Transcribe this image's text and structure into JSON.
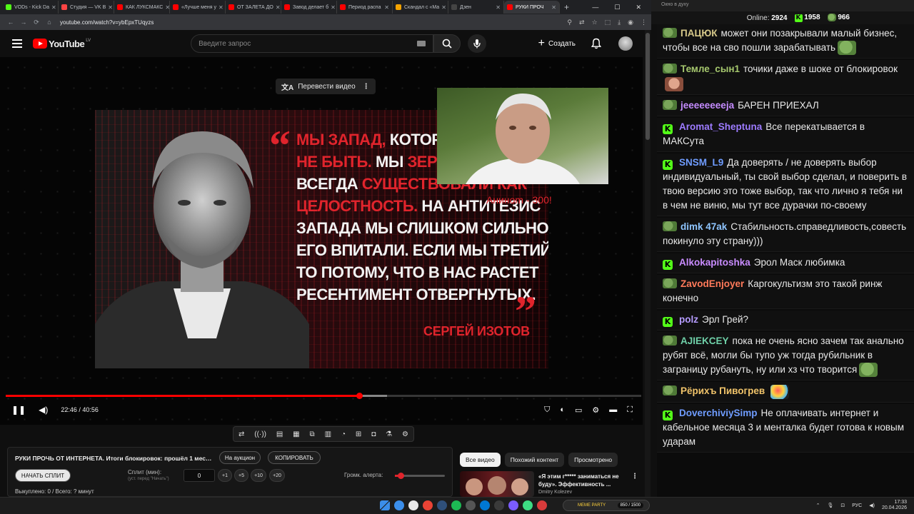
{
  "browser": {
    "tabs": [
      {
        "label": "VODs - Kick Da",
        "color": "#53fc18"
      },
      {
        "label": "Студия — VK В",
        "color": "#ff4444"
      },
      {
        "label": "КАК ЛУКСМАКС",
        "color": "#ff0000"
      },
      {
        "label": "«Лучше меня у",
        "color": "#ff0000"
      },
      {
        "label": "ОТ ЗАЛЕТА ДО",
        "color": "#ff0000"
      },
      {
        "label": "Завод делает б",
        "color": "#ff0000"
      },
      {
        "label": "Период распа",
        "color": "#ff0000"
      },
      {
        "label": "Скандал с «Ма",
        "color": "#f4a300"
      },
      {
        "label": "Дзен",
        "color": "#444444"
      },
      {
        "label": "РУКИ ПРОЧ",
        "color": "#ff0000"
      }
    ],
    "url": "youtube.com/watch?v=ybEpxTUqyzs"
  },
  "youtube": {
    "logo_text": "YouTube",
    "region": "LV",
    "search_placeholder": "Введите запрос",
    "create_label": "Создать"
  },
  "player": {
    "translate_label": "Перевести видео",
    "quote_lines": [
      [
        {
          "t": "Мы запад, ",
          "red": true
        },
        {
          "t": "который с",
          "red": false
        }
      ],
      [
        {
          "t": "не быть. ",
          "red": true
        },
        {
          "t": "Мы ",
          "red": false
        },
        {
          "t": "зеркало",
          "red": true
        }
      ],
      [
        {
          "t": "всегда  ",
          "red": false
        },
        {
          "t": "существовали как",
          "red": true
        }
      ],
      [
        {
          "t": "целостность. ",
          "red": true
        },
        {
          "t": "На антитезис",
          "red": false
        }
      ],
      [
        {
          "t": "запада мы слишком сильно",
          "red": false
        }
      ],
      [
        {
          "t": "его впитали. Если мы третий путь,",
          "red": false
        }
      ],
      [
        {
          "t": "то потому, что в нас растет",
          "red": false
        }
      ],
      [
        {
          "t": "ресентимент отвергнутых.",
          "red": false
        }
      ]
    ],
    "author": "СЕРГЕЙ ИЗОТОВ",
    "overlay_caption": "Аниноm - 300!",
    "time_current": "22:46",
    "time_total": "40:56",
    "time_display": "22:46 / 40:56",
    "progress_played": 0.556,
    "progress_buffered": 0.6
  },
  "split_panel": {
    "title": "РУКИ ПРОЧЬ ОТ ИНТЕРНЕТА. Итоги блокировок: прошёл 1 месяц...",
    "auction_btn": "На аукцион",
    "copy_btn": "КОПИРОВАТЬ",
    "start_split_btn": "НАЧАТЬ СПЛИТ",
    "split_label": "Сплит (мин):",
    "split_sub": "(уст. перед \"Начать\")",
    "split_value": "0",
    "increments": [
      "+1",
      "+5",
      "+10",
      "+20"
    ],
    "alert_label": "Громк. алерта:",
    "alert_level": 0.12,
    "bought": "Выкуплено: 0 / Всего: ? минут"
  },
  "chips": [
    "Все видео",
    "Похожий контент",
    "Просмотрено"
  ],
  "recommendation": {
    "title": "«Я этим г***** заниматься не буду». Эффективность ...",
    "channel": "Dmitry Kolezev"
  },
  "chat": {
    "window_title": "Окно в духу",
    "online_label": "Online:",
    "online_count": "2924",
    "stat_k": "1958",
    "stat_p": "966",
    "messages": [
      {
        "badge": "pepe",
        "user": "ПАЦЮК",
        "color": "#d7c98a",
        "text": "может они позакрывали малый бизнес, чтобы все на сво пошли зарабатывать",
        "emote": "pepe"
      },
      {
        "badge": "pepe",
        "user": "Темле_сын1",
        "color": "#a6c86e",
        "text": "точики даже в шоке от блокировок",
        "emote": "face"
      },
      {
        "badge": "pepe",
        "user": "jeeeeeeeeja",
        "color": "#c58cff",
        "text": "БАРЕН ПРИЕХАЛ",
        "emote": ""
      },
      {
        "badge": "kick",
        "user": "Aromat_Sheptuna",
        "color": "#9d7bff",
        "text": "Все перекатывается в МАКСута",
        "emote": ""
      },
      {
        "badge": "kick",
        "user": "SNSM_L9",
        "color": "#6f9cff",
        "text": "Да доверять / не доверять выбор индивидуальный, ты свой выбор сделал, и поверить в твою версию это тоже выбор, так что лично я тебя ни в чем не виню, мы тут все дурачки по-своему",
        "emote": ""
      },
      {
        "badge": "pepe",
        "user": "dimk 47ak",
        "color": "#8ec5ff",
        "text": "Стабильность.справедливость,совесть покинуло эту страну)))",
        "emote": ""
      },
      {
        "badge": "kick",
        "user": "Alkokapitoshka",
        "color": "#c98cff",
        "text": "Эрол Маск любимка",
        "emote": ""
      },
      {
        "badge": "pepe",
        "user": "ZavodEnjoyer",
        "color": "#ff7a5a",
        "text": "Каргокультизм это такой ринж конечно",
        "emote": ""
      },
      {
        "badge": "kick",
        "user": "polz",
        "color": "#b59cff",
        "text": "Эрл Грей?",
        "emote": ""
      },
      {
        "badge": "pepe",
        "user": "AJIEKCEY",
        "color": "#6fd0a8",
        "text": "пока не очень ясно зачем так анально рубят всё, могли бы тупо уж тогда рубильник в заграницу рубануть, ну или хз что творится",
        "emote": "pepe"
      },
      {
        "badge": "pepe",
        "user": "Рёрихъ Пивогрев",
        "color": "#f0c36a",
        "text": "",
        "emote": "parrot"
      },
      {
        "badge": "kick",
        "user": "DoverchiviySimp",
        "color": "#6f9cff",
        "text": "Не оплачивать интернет и кабельное месяца 3 и менталка будет готова к новым ударам",
        "emote": ""
      }
    ]
  },
  "taskbar": {
    "meme_label": "MEME PARTY",
    "meme_count": "850 / 1500",
    "lang": "РУС",
    "time": "17:33",
    "date": "20.04.2026",
    "apps": [
      "#3b8eea",
      "#e8e8e8",
      "#ea4335",
      "#2f4f7a",
      "#1db954",
      "#555555",
      "#0078d4",
      "#3a3a3a",
      "#7a5cff",
      "#3ddc84",
      "#d83b3b"
    ]
  }
}
